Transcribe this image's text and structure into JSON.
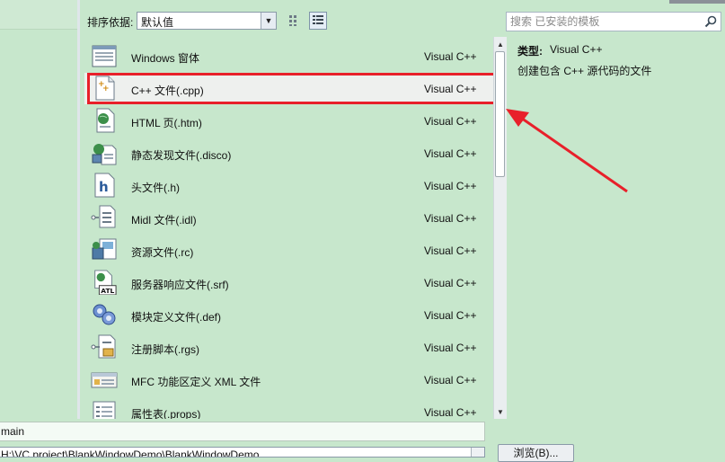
{
  "toolbar": {
    "sort_label": "排序依据:",
    "sort_value": "默认值"
  },
  "search": {
    "placeholder": "搜索 已安装的模板"
  },
  "templates": [
    {
      "name": "Windows 窗体",
      "type": "Visual C++",
      "icon": "windows-form-icon"
    },
    {
      "name": "C++ 文件(.cpp)",
      "type": "Visual C++",
      "icon": "cpp-file-icon"
    },
    {
      "name": "HTML 页(.htm)",
      "type": "Visual C++",
      "icon": "html-page-icon"
    },
    {
      "name": "静态发现文件(.disco)",
      "type": "Visual C++",
      "icon": "disco-file-icon"
    },
    {
      "name": "头文件(.h)",
      "type": "Visual C++",
      "icon": "header-file-icon"
    },
    {
      "name": "Midl 文件(.idl)",
      "type": "Visual C++",
      "icon": "midl-file-icon"
    },
    {
      "name": "资源文件(.rc)",
      "type": "Visual C++",
      "icon": "resource-file-icon"
    },
    {
      "name": "服务器响应文件(.srf)",
      "type": "Visual C++",
      "icon": "atl-srf-icon"
    },
    {
      "name": "模块定义文件(.def)",
      "type": "Visual C++",
      "icon": "def-file-icon"
    },
    {
      "name": "注册脚本(.rgs)",
      "type": "Visual C++",
      "icon": "rgs-file-icon"
    },
    {
      "name": "MFC 功能区定义 XML 文件",
      "type": "Visual C++",
      "icon": "mfc-ribbon-icon"
    },
    {
      "name": "属性表(.props)",
      "type": "Visual C++",
      "icon": "props-file-icon"
    }
  ],
  "info": {
    "type_label": "类型:",
    "type_value": "Visual C++",
    "description": "创建包含 C++ 源代码的文件"
  },
  "bottom": {
    "name_value": "main",
    "path_value": "H:\\VC project\\BlankWindowDemo\\BlankWindowDemo",
    "browse_label": "浏览(B)..."
  },
  "colors": {
    "background": "#c7e7cc",
    "highlight_box": "#e8202a",
    "annotation_arrow": "#e8202a"
  }
}
